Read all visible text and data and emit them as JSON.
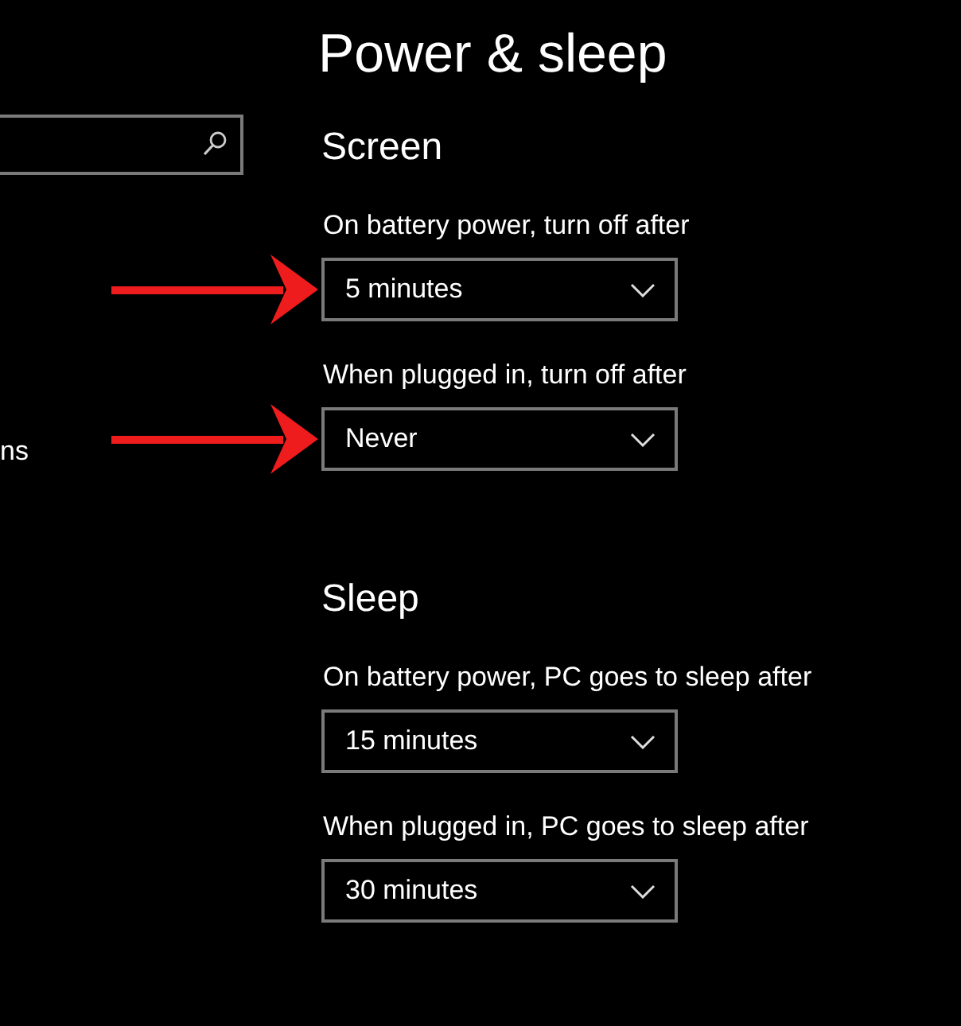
{
  "nav": {
    "items": [
      {
        "label": "ns"
      }
    ]
  },
  "page": {
    "title": "Power & sleep"
  },
  "sections": [
    {
      "heading": "Screen",
      "settings": [
        {
          "label": "On battery power, turn off after",
          "value": "5 minutes",
          "arrow": true
        },
        {
          "label": "When plugged in, turn off after",
          "value": "Never",
          "arrow": true
        }
      ]
    },
    {
      "heading": "Sleep",
      "settings": [
        {
          "label": "On battery power, PC goes to sleep after",
          "value": "15 minutes",
          "arrow": false
        },
        {
          "label": "When plugged in, PC goes to sleep after",
          "value": "30 minutes",
          "arrow": false
        }
      ]
    }
  ]
}
